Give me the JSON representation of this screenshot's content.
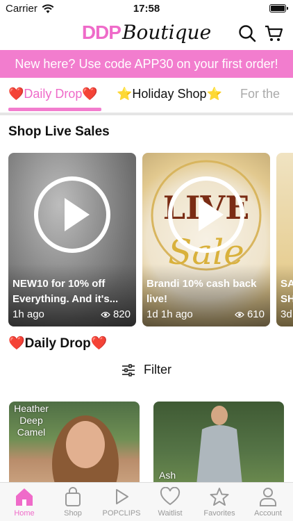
{
  "status": {
    "carrier": "Carrier",
    "time": "17:58"
  },
  "header": {
    "logo_ddp": "DDP",
    "logo_boutique": "Boutique"
  },
  "promo": {
    "text": "New here? Use code APP30 on your first order!"
  },
  "tabs": [
    {
      "label": "❤️Daily Drop❤️",
      "active": true
    },
    {
      "label": "⭐Holiday Shop⭐",
      "active": false
    },
    {
      "label": "For the",
      "active": false
    }
  ],
  "live_section": {
    "title": "Shop Live Sales",
    "cards": [
      {
        "title": "NEW10 for 10% off Everything. And it's...",
        "time": "1h ago",
        "views": "820"
      },
      {
        "title": "Brandi 10% cash back live!",
        "time": "1d 1h ago",
        "views": "610",
        "image_text": "LIVE Sale"
      },
      {
        "title": "SA SH",
        "time": "3d"
      }
    ]
  },
  "daily_drop": {
    "title": "❤️Daily Drop❤️",
    "filter_label": "Filter"
  },
  "products": [
    {
      "label": "Heather Deep Camel"
    },
    {
      "label": "Ash"
    }
  ],
  "tabbar": [
    {
      "label": "Home",
      "icon": "home-icon",
      "active": true
    },
    {
      "label": "Shop",
      "icon": "bag-icon"
    },
    {
      "label": "POPCLIPS",
      "icon": "play-icon"
    },
    {
      "label": "Waitlist",
      "icon": "heart-icon"
    },
    {
      "label": "Favorites",
      "icon": "star-icon"
    },
    {
      "label": "Account",
      "icon": "person-icon"
    }
  ],
  "colors": {
    "accent": "#ef6bc9",
    "promo_bg": "#f27dce"
  }
}
